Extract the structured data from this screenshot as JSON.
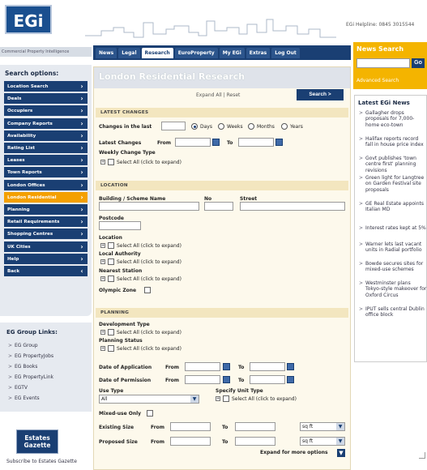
{
  "header": {
    "logo": "EGi",
    "helpline": "EGi Helpline: 0845 3015544",
    "tagline": "Commercial Property Intelligence"
  },
  "nav": {
    "tabs": [
      "News",
      "Legal",
      "Research",
      "EuroProperty",
      "My EGi",
      "Extras",
      "Log Out"
    ],
    "active": "Research"
  },
  "news_search": {
    "title": "News Search",
    "go": "Go",
    "advanced": "Advanced Search"
  },
  "sidebar": {
    "title": "Search options:",
    "items": [
      "Location Search",
      "Deals",
      "Occupiers",
      "Company Reports",
      "Availability",
      "Rating List",
      "Leases",
      "Town Reports",
      "London Offices",
      "London Residential",
      "Planning",
      "Retail Requirements",
      "Shopping Centres",
      "UK Cities",
      "Help",
      "Back"
    ],
    "active": "London Residential"
  },
  "group_links": {
    "title": "EG Group Links:",
    "items": [
      "EG Group",
      "EG PropertyJobs",
      "EG Books",
      "EG PropertyLink",
      "EGTV",
      "EG Events"
    ]
  },
  "eg_logo": {
    "line1": "Estates",
    "line2": "Gazette"
  },
  "subscribe": "Subscribe to Estates Gazette",
  "main": {
    "title": "London Residential Research",
    "expand_all": "Expand All | Reset",
    "search_label": "Search"
  },
  "latest_changes": {
    "heading": "LATEST CHANGES",
    "changes_in_last": "Changes in the last",
    "units": [
      "Days",
      "Weeks",
      "Months",
      "Years"
    ],
    "selected_unit": "Days",
    "latest_changes_label": "Latest Changes",
    "from": "From",
    "to": "To",
    "weekly_change_type": "Weekly Change Type",
    "select_all": "Select All (click to expand)"
  },
  "location": {
    "heading": "LOCATION",
    "building": "Building / Scheme Name",
    "no": "No",
    "street": "Street",
    "postcode": "Postcode",
    "location": "Location",
    "select_all": "Select All (click to expand)",
    "local_authority": "Local Authority",
    "nearest_station": "Nearest Station",
    "olympic_zone": "Olympic Zone"
  },
  "planning": {
    "heading": "PLANNING",
    "development_type": "Development Type",
    "select_all": "Select All (click to expand)",
    "planning_status": "Planning Status",
    "date_of_application": "Date of Application",
    "date_of_permission": "Date of Permission",
    "from": "From",
    "to": "To",
    "use_type": "Use Type",
    "use_type_value": "All",
    "specify_unit_type": "Specify Unit Type",
    "mixed_use_only": "Mixed-use Only",
    "existing_size": "Existing Size",
    "proposed_size": "Proposed Size",
    "unit": "sq ft",
    "expand_more": "Expand for more options"
  },
  "latest_news": {
    "title": "Latest EGi News",
    "items": [
      "Gallagher drops proposals for 7,000-home eco-town",
      "Halifax reports record fall in house price index",
      "Govt publishes 'town centre first' planning revisions",
      "Green light for Langtree on Garden Festival site proposals",
      "GE Real Estate appoints Italian MD",
      "Interest rates kept at 5%",
      "Warner lets last vacant units in Radial portfolio",
      "Bowde secures sites for mixed-use schemes",
      "Westminster plans Tokyo-style makeover for Oxford Circus",
      "IPUT sells central Dublin office block"
    ]
  }
}
